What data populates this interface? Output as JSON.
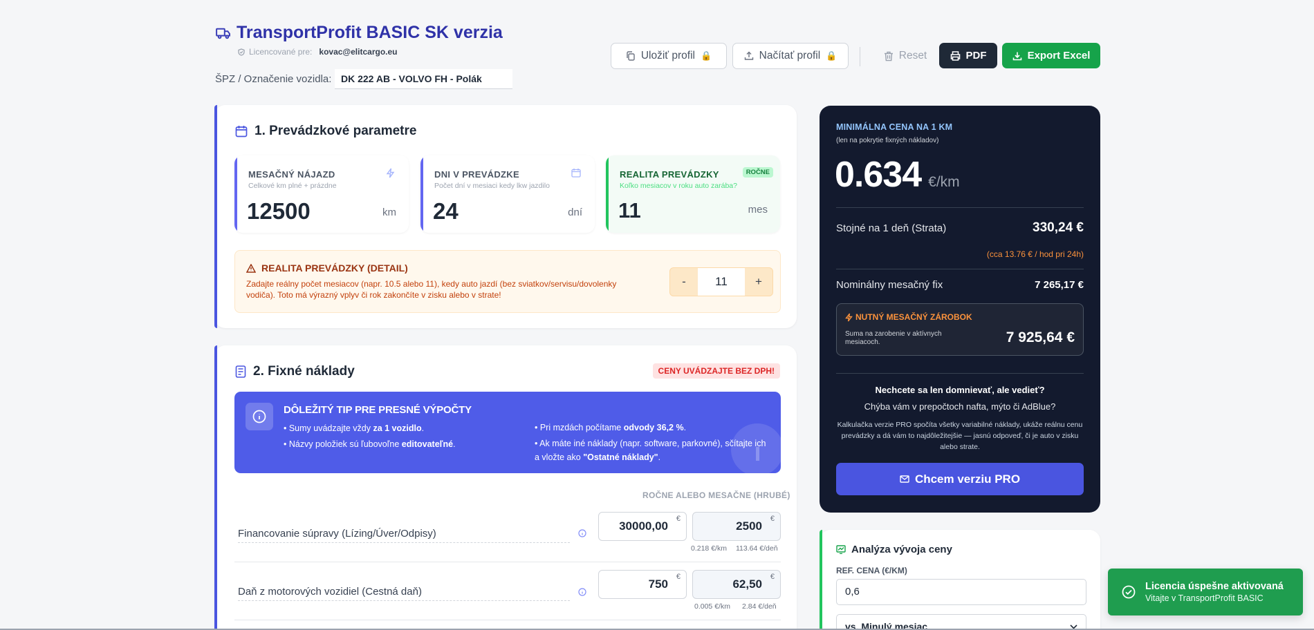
{
  "header": {
    "title": "TransportProfit BASIC SK verzia",
    "license_label": "Licencované pre:",
    "license_email": "kovac@elitcargo.eu",
    "vehicle_label": "ŠPZ / Označenie vozidla:",
    "vehicle_value": "DK 222 AB - VOLVO FH - Polák"
  },
  "toolbar": {
    "save_label": "Uložiť profil",
    "load_label": "Načítať profil",
    "reset_label": "Reset",
    "pdf_label": "PDF",
    "excel_label": "Export Excel"
  },
  "section1": {
    "title": "1. Prevádzkové parametre",
    "stats": [
      {
        "label": "MESAČNÝ NÁJAZD",
        "sub": "Celkové km plné + prázdne",
        "value": "12500",
        "unit": "km"
      },
      {
        "label": "DNI V PREVÁDZKE",
        "sub": "Počet dní v mesiaci kedy lkw jazdilo",
        "value": "24",
        "unit": "dní"
      },
      {
        "label": "REALITA PREVÁDZKY",
        "sub": "Koľko mesiacov v roku auto zarába?",
        "value": "11",
        "unit": "mes",
        "badge": "ROČNE"
      }
    ],
    "detail": {
      "title": "REALITA PREVÁDZKY (DETAIL)",
      "text": "Zadajte reálny počet mesiacov (napr. 10.5 alebo 11), kedy auto jazdí (bez sviatkov/servisu/dovolenky vodiča). Toto má výrazný vplyv či rok zakončíte v zisku alebo v strate!",
      "minus": "-",
      "value": "11",
      "plus": "+"
    }
  },
  "section2": {
    "title": "2. Fixné náklady",
    "badge": "CENY UVÁDZAJTE BEZ DPH!",
    "tip": {
      "title": "DÔLEŽITÝ TIP PRE PRESNÉ VÝPOČTY",
      "l1a": "• Sumy uvádzajte vždy ",
      "l1b": "za 1 vozidlo",
      "l1c": ".",
      "l2a": "• Názvy položiek sú ľubovoľne ",
      "l2b": "editovateľné",
      "l2c": ".",
      "r1a": "• Pri mzdách počítame ",
      "r1b": "odvody 36,2 %",
      "r1c": ".",
      "r2a": "• Ak máte iné náklady (napr. software, parkovné), sčítajte ich a vložte ako ",
      "r2b": "\"Ostatné náklady\"",
      "r2c": "."
    },
    "col_header": "ROČNE ALEBO MESAČNE (HRUBÉ)",
    "rows": [
      {
        "name": "Financovanie súpravy (Lízing/Úver/Odpisy)",
        "yearly": "30000,00",
        "monthly": "2500",
        "per_km": "0.218 €/km",
        "per_day": "113.64 €/deň"
      },
      {
        "name": "Daň z motorových vozidiel (Cestná daň)",
        "yearly": "750",
        "monthly": "62,50",
        "per_km": "0.005 €/km",
        "per_day": "2.84 €/deň"
      }
    ],
    "eur": "€"
  },
  "result": {
    "title": "MINIMÁLNA CENA NA 1 KM",
    "subtitle": "(len na pokrytie fixných nákladov)",
    "price": "0.634",
    "price_unit": "€/km",
    "daily_label": "Stojné na 1 deň (Strata)",
    "daily_value": "330,24 €",
    "hourly_note": "(cca 13.76 € / hod pri 24h)",
    "monthly_fix_label": "Nominálny mesačný fix",
    "monthly_fix_value": "7 265,17 €",
    "needed_title": "NUTNÝ MESAČNÝ ZÁROBOK",
    "needed_text": "Suma na zarobenie v aktívnych mesiacoch.",
    "needed_value": "7 925,64 €",
    "promo_q": "Nechcete sa len domnievať, ale vedieť?",
    "promo_sub": "Chýba vám v prepočtoch nafta, mýto či AdBlue?",
    "promo_text": "Kalkulačka verzie PRO spočíta všetky variabilné náklady, ukáže reálnu cenu prevádzky a dá vám to najdôležitejšie — jasnú odpoveď, či je auto v zisku alebo strate.",
    "cta": "Chcem verziu PRO"
  },
  "analysis": {
    "title": "Analýza vývoja ceny",
    "ref_label": "REF. CENA (€/KM)",
    "ref_value": "0,6",
    "select_value": "vs. Minulý mesiac"
  },
  "toast": {
    "title": "Licencia úspešne aktivovaná",
    "text": "Vitajte v TransportProfit BASIC"
  },
  "colors": {
    "primary": "#4a55e0",
    "dark_panel": "#131a2e",
    "green": "#16a34a",
    "orange": "#f59e0b"
  }
}
